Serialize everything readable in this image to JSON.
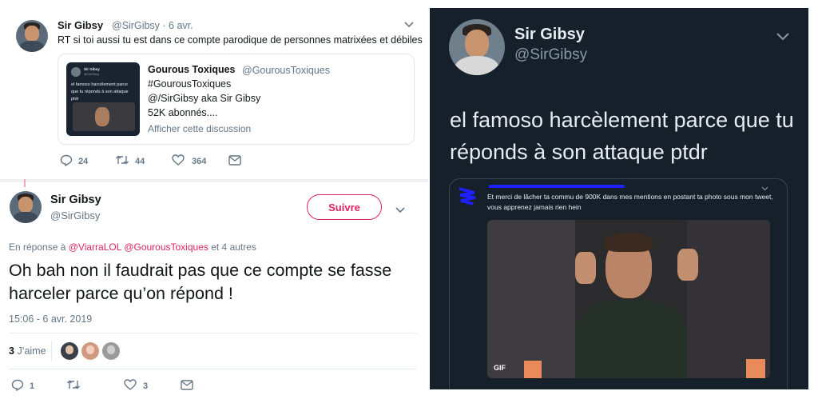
{
  "tweet1": {
    "name": "Sir Gibsy",
    "handle_time": "@SirGibsy · 6 avr.",
    "text": "RT si toi aussi tu est dans ce compte parodique de personnes matrixées et débiles",
    "quote": {
      "name": "Gourous Toxiques",
      "handle": "@GourousToxiques",
      "lines": [
        "#GourousToxiques",
        "@/SirGibsy aka Sir Gibsy",
        "52K abonnés....",
        "Afficher cette discussion"
      ],
      "thumb_name": "Sir Gibsy",
      "thumb_handle": "@SirGibsy",
      "thumb_text": "el famoso harcèlement parce que tu réponds à son attaque ptdr"
    },
    "actions": {
      "reply": "24",
      "retweet": "44",
      "like": "364"
    }
  },
  "tweet2": {
    "name": "Sir Gibsy",
    "handle": "@SirGibsy",
    "follow_label": "Suivre",
    "reply_prefix": "En réponse à",
    "reply_to_1": "@ViarraLOL",
    "reply_to_2": "@GourousToxiques",
    "reply_suffix": "et 4 autres",
    "text": "Oh bah non il faudrait pas que ce compte se fasse harceler parce qu’on répond !",
    "timestamp": "15:06 - 6 avr. 2019",
    "likes_count": "3",
    "likes_label": "J’aime",
    "actions": {
      "reply": "1",
      "like": "3"
    }
  },
  "dark": {
    "name": "Sir Gibsy",
    "handle": "@SirGibsy",
    "text": "el famoso harcèlement parce que tu réponds à son attaque ptdr",
    "quote_text": "Et merci de lâcher ta commu de 900K dans mes mentions en postant ta photo sous mon tweet, vous apprenez jamais rien hein",
    "gif_label": "GIF"
  },
  "colors": {
    "accent": "#1da1f2",
    "follow": "#e0245e",
    "dark_bg": "#15202b",
    "redact": "#1f1fff"
  }
}
